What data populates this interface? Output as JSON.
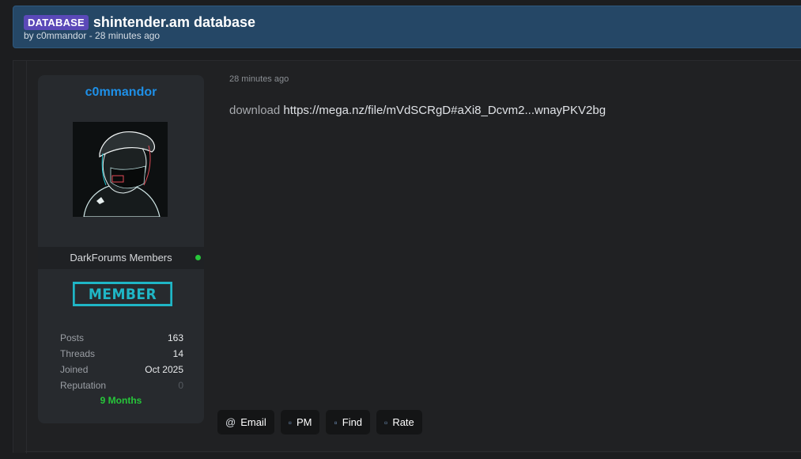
{
  "thread": {
    "prefix": "DATABASE",
    "title": "shintender.am database",
    "byline": "by c0mmandor - 28 minutes ago"
  },
  "author": {
    "username": "c0mmandor",
    "group": "DarkForums Members",
    "rank_badge": "MEMBER",
    "stats": [
      {
        "label": "Posts",
        "value": "163"
      },
      {
        "label": "Threads",
        "value": "14"
      },
      {
        "label": "Joined",
        "value": "Oct 2025"
      },
      {
        "label": "Reputation",
        "value": "0"
      }
    ],
    "tenure": "9 Months",
    "online_color": "#27c63a"
  },
  "post": {
    "date": "28 minutes ago",
    "body_word": "download",
    "body_link": "https://mega.nz/file/mVdSCRgD#aXi8_Dcvm2...wnayPKV2bg"
  },
  "actions": [
    {
      "label": "Email",
      "icon": "at-icon"
    },
    {
      "label": "PM",
      "icon": "message-icon"
    },
    {
      "label": "Find",
      "icon": "search-icon"
    },
    {
      "label": "Rate",
      "icon": "star-icon"
    }
  ],
  "colors": {
    "header_bg": "#254766",
    "prefix_bg": "#5b49b8",
    "username": "#1e90e8",
    "badge": "#1fb6c6"
  }
}
